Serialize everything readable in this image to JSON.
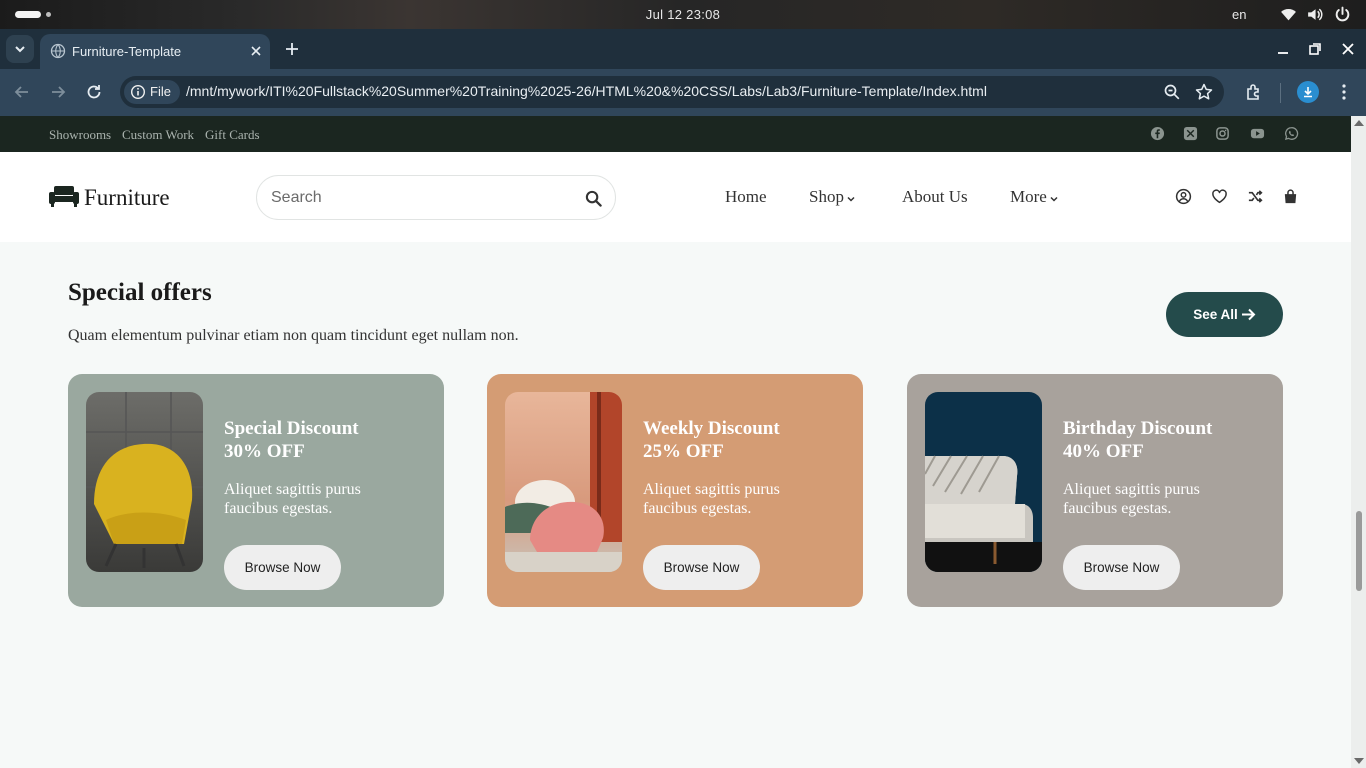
{
  "os": {
    "clock": "Jul 12  23:08",
    "language": "en"
  },
  "browser": {
    "tab_title": "Furniture-Template",
    "omnibox_chip": "File",
    "url": "/mnt/mywork/ITI%20Fullstack%20Summer%20Training%2025-26/HTML%20&%20CSS/Labs/Lab3/Furniture-Template/Index.html"
  },
  "topbar": {
    "links": [
      "Showrooms",
      "Custom Work",
      "Gift Cards"
    ],
    "social_icons": [
      "facebook-icon",
      "x-icon",
      "instagram-icon",
      "youtube-icon",
      "whatsapp-icon"
    ]
  },
  "header": {
    "logo": "Furniture",
    "search_placeholder": "Search",
    "nav": [
      "Home",
      "Shop",
      "About Us",
      "More"
    ],
    "icons": [
      "user-icon",
      "heart-icon",
      "shuffle-icon",
      "bag-icon"
    ]
  },
  "offers": {
    "title": "Special offers",
    "subtitle": "Quam elementum pulvinar etiam non quam tincidunt eget nullam non.",
    "see_all": "See All",
    "cards": [
      {
        "title": "Special Discount 30% OFF",
        "title_line1": "Special Discount",
        "title_line2": "30% OFF",
        "description": "Aliquet sagittis purus faucibus egestas.",
        "button": "Browse Now",
        "bg_color": "#9aa89f"
      },
      {
        "title": "Weekly Discount 25% OFF",
        "title_line1": "Weekly Discount",
        "title_line2": "25% OFF",
        "description": "Aliquet sagittis purus faucibus egestas.",
        "button": "Browse Now",
        "bg_color": "#d49c74"
      },
      {
        "title": "Birthday Discount 40% OFF",
        "title_line1": "Birthday Discount",
        "title_line2": "40% OFF",
        "description": "Aliquet sagittis purus faucibus egestas.",
        "button": "Browse Now",
        "bg_color": "#a8a29c"
      }
    ]
  },
  "colors": {
    "topbar_bg": "#1b2620",
    "accent_button": "#244b4b",
    "page_bg": "#f6f9f8"
  }
}
